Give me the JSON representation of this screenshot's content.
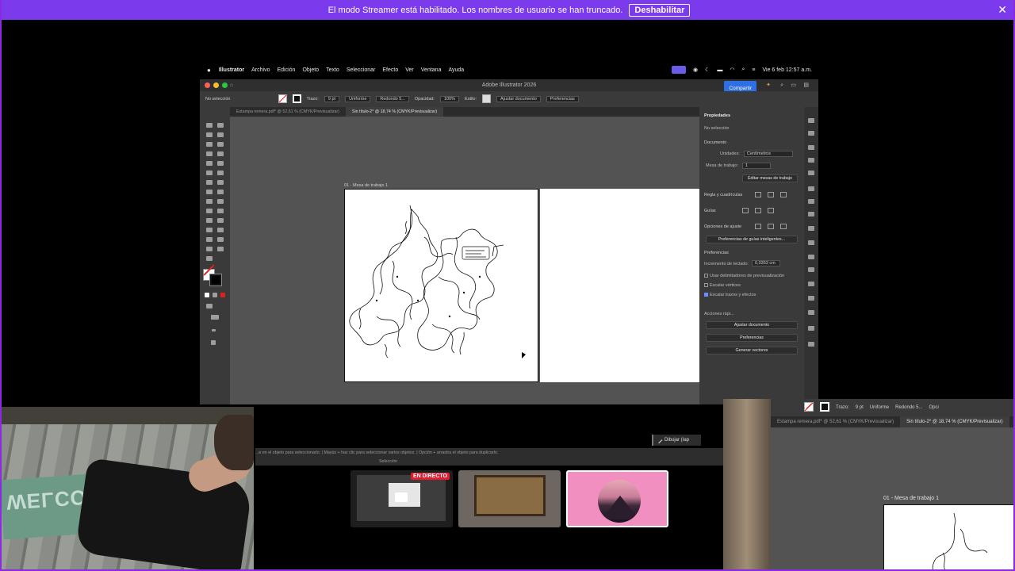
{
  "banner": {
    "message": "El modo Streamer está habilitado. Los nombres de usuario se han truncado.",
    "button": "Deshabilitar",
    "close": "✕"
  },
  "macbar": {
    "apple": "",
    "menus": [
      "Illustrator",
      "Archivo",
      "Edición",
      "Objeto",
      "Texto",
      "Seleccionar",
      "Efecto",
      "Ver",
      "Ventana",
      "Ayuda"
    ],
    "clock": "Vie 6 feb 12:57 a.m."
  },
  "window": {
    "title": "Adobe Illustrator 2026",
    "share": "Compartir"
  },
  "control": {
    "selection": "No selección",
    "stroke_label": "Trazo:",
    "stroke_value": "9 pt",
    "profile": "Uniforme",
    "brush": "Redondo 5...",
    "opacity_label": "Opacidad:",
    "opacity_value": "100%",
    "style_label": "Estilo:",
    "adjust_doc": "Ajustar documento",
    "preferences": "Preferencias"
  },
  "tabs": [
    {
      "label": "Estampa remera.pdf* @ 52,61 % (CMYK/Previsualizar)",
      "active": false
    },
    {
      "label": "Sin título-2* @ 18,74 % (CMYK/Previsualizar)",
      "active": true
    }
  ],
  "artboard": {
    "label": "01 - Mesa de trabajo 1"
  },
  "properties": {
    "title": "Propiedades",
    "no_selection": "No selección",
    "document": "Documento",
    "units_label": "Unidades:",
    "units_value": "Centímetros",
    "artboard_label": "Mesa de trabajo:",
    "artboard_value": "1",
    "edit_artboards": "Editar mesas de trabajo",
    "rulers": "Regla y cuadrículas",
    "guides": "Guías",
    "snap": "Opciones de ajuste",
    "smart_guides": "Preferencias de guías inteligentes...",
    "prefs_section": "Preferencias",
    "keyboard_inc_label": "Incremento de teclado:",
    "keyboard_inc_value": "0,0353 cm",
    "cb_preview_bounds": "Usar delimitadores de previsualización",
    "cb_scale_corners": "Escalar vértices",
    "cb_scale_strokes": "Escalar trazos y efectos",
    "quick_actions": "Acciones rápi...",
    "btn_adjust": "Ajustar documento",
    "btn_prefs": "Preferencias",
    "btn_vectors": "Generar vectores"
  },
  "status": {
    "hint": "...e en el objeto para seleccionarlo. | Mayús + haz clic para seleccionar varios objetos. | Opción + arrastra el objeto para duplicarlo.",
    "mode": "Selección"
  },
  "draw_button": "Dibujar (Iap",
  "webcam": {
    "mat_text": "WELCOME"
  },
  "thumbnails": {
    "live_badge": "EN DIRECTO"
  },
  "right_copy": {
    "stroke_label": "Trazo:",
    "stroke_value": "9 pt",
    "profile": "Uniforme",
    "brush": "Redondo 5...",
    "more": "Opci",
    "tab1": "Estampa remera.pdf* @ 52,61 % (CMYK/Previsualizar)",
    "tab2": "Sin título-2* @ 18,74 % (CMYK/Previsualizar)",
    "artboard_label": "01 - Mesa de trabajo 1"
  }
}
